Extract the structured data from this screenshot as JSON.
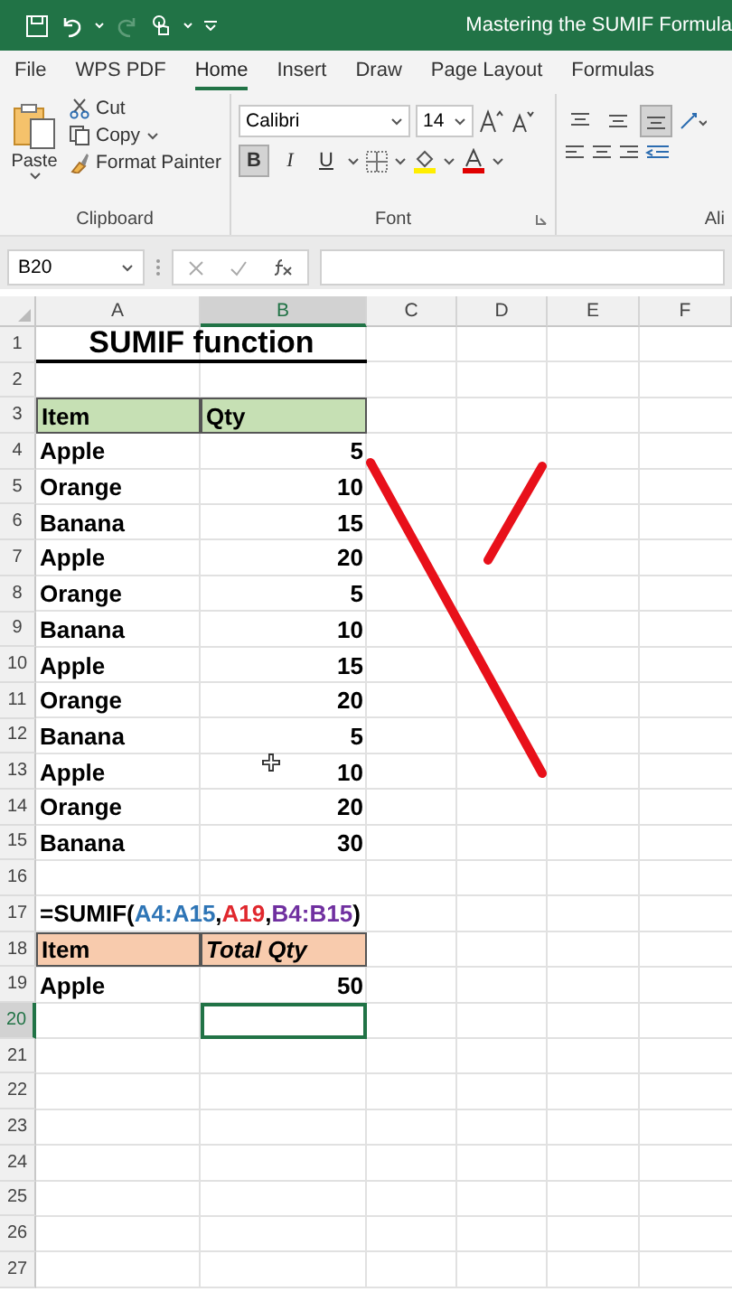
{
  "title_bar": {
    "title": "Mastering the SUMIF Formula"
  },
  "menu_tabs": [
    {
      "label": "File",
      "selected": false
    },
    {
      "label": "WPS PDF",
      "selected": false
    },
    {
      "label": "Home",
      "selected": true
    },
    {
      "label": "Insert",
      "selected": false
    },
    {
      "label": "Draw",
      "selected": false
    },
    {
      "label": "Page Layout",
      "selected": false
    },
    {
      "label": "Formulas",
      "selected": false
    }
  ],
  "ribbon": {
    "clipboard": {
      "paste": "Paste",
      "cut": "Cut",
      "copy": "Copy",
      "format_painter": "Format Painter",
      "label": "Clipboard"
    },
    "font": {
      "font_name": "Calibri",
      "font_size": "14",
      "style_buttons": [
        {
          "label": "B",
          "selected": true
        },
        {
          "label": "I",
          "selected": false
        },
        {
          "label": "U",
          "selected": false
        }
      ],
      "label": "Font"
    },
    "alignment": {
      "bottom_align_selected": true,
      "label": "Ali"
    }
  },
  "formula_bar": {
    "name_box": "B20"
  },
  "columns": [
    {
      "label": "A",
      "selected": false
    },
    {
      "label": "B",
      "selected": true
    },
    {
      "label": "C",
      "selected": false
    },
    {
      "label": "D",
      "selected": false
    },
    {
      "label": "E",
      "selected": false
    },
    {
      "label": "F",
      "selected": false
    }
  ],
  "rows": [
    {
      "number": "1",
      "kind": "title",
      "selected": false,
      "cells": [
        {
          "text": "SUMIF function"
        }
      ]
    },
    {
      "number": "2",
      "kind": "empty",
      "selected": false
    },
    {
      "number": "3",
      "kind": "header",
      "selected": false,
      "color": "#c6e0b4",
      "cells": [
        {
          "text": "Item",
          "italic": false
        },
        {
          "text": "Qty",
          "italic": false
        }
      ]
    },
    {
      "number": "4",
      "kind": "data",
      "selected": false,
      "cells": [
        {
          "text": "Apple"
        },
        {
          "text": "5"
        }
      ]
    },
    {
      "number": "5",
      "kind": "data",
      "selected": false,
      "cells": [
        {
          "text": "Orange"
        },
        {
          "text": "10"
        }
      ]
    },
    {
      "number": "6",
      "kind": "data",
      "selected": false,
      "cells": [
        {
          "text": "Banana"
        },
        {
          "text": "15"
        }
      ]
    },
    {
      "number": "7",
      "kind": "data",
      "selected": false,
      "cells": [
        {
          "text": "Apple"
        },
        {
          "text": "20"
        }
      ]
    },
    {
      "number": "8",
      "kind": "data",
      "selected": false,
      "cells": [
        {
          "text": "Orange"
        },
        {
          "text": "5"
        }
      ]
    },
    {
      "number": "9",
      "kind": "data",
      "selected": false,
      "cells": [
        {
          "text": "Banana"
        },
        {
          "text": "10"
        }
      ]
    },
    {
      "number": "10",
      "kind": "data",
      "selected": false,
      "cells": [
        {
          "text": "Apple"
        },
        {
          "text": "15"
        }
      ]
    },
    {
      "number": "11",
      "kind": "data",
      "selected": false,
      "cells": [
        {
          "text": "Orange"
        },
        {
          "text": "20"
        }
      ]
    },
    {
      "number": "12",
      "kind": "data",
      "selected": false,
      "cells": [
        {
          "text": "Banana"
        },
        {
          "text": "5"
        }
      ]
    },
    {
      "number": "13",
      "kind": "data",
      "selected": false,
      "cells": [
        {
          "text": "Apple"
        },
        {
          "text": "10"
        }
      ]
    },
    {
      "number": "14",
      "kind": "data",
      "selected": false,
      "cells": [
        {
          "text": "Orange"
        },
        {
          "text": "20"
        }
      ]
    },
    {
      "number": "15",
      "kind": "data",
      "selected": false,
      "cells": [
        {
          "text": "Banana"
        },
        {
          "text": "30"
        }
      ]
    },
    {
      "number": "16",
      "kind": "empty",
      "selected": false
    },
    {
      "number": "17",
      "kind": "formula",
      "selected": false,
      "parts": [
        {
          "text": "=SUMIF(",
          "color": "#000000"
        },
        {
          "text": "A4:A15",
          "color": "#2e75b6"
        },
        {
          "text": ",",
          "color": "#000000"
        },
        {
          "text": "A19",
          "color": "#e0282e"
        },
        {
          "text": ",",
          "color": "#000000"
        },
        {
          "text": "B4:B15",
          "color": "#7030a0"
        },
        {
          "text": ")",
          "color": "#000000"
        }
      ]
    },
    {
      "number": "18",
      "kind": "header",
      "selected": false,
      "color": "#f8cbad",
      "cells": [
        {
          "text": "Item",
          "italic": false
        },
        {
          "text": "Total Qty",
          "italic": true
        }
      ]
    },
    {
      "number": "19",
      "kind": "data",
      "selected": false,
      "cells": [
        {
          "text": "Apple"
        },
        {
          "text": "50"
        }
      ]
    },
    {
      "number": "20",
      "kind": "empty",
      "selected": true
    },
    {
      "number": "21",
      "kind": "empty",
      "selected": false
    },
    {
      "number": "22",
      "kind": "empty",
      "selected": false
    },
    {
      "number": "23",
      "kind": "empty",
      "selected": false
    },
    {
      "number": "24",
      "kind": "empty",
      "selected": false
    },
    {
      "number": "25",
      "kind": "empty",
      "selected": false
    },
    {
      "number": "26",
      "kind": "empty",
      "selected": false
    },
    {
      "number": "27",
      "kind": "empty",
      "selected": false
    }
  ]
}
